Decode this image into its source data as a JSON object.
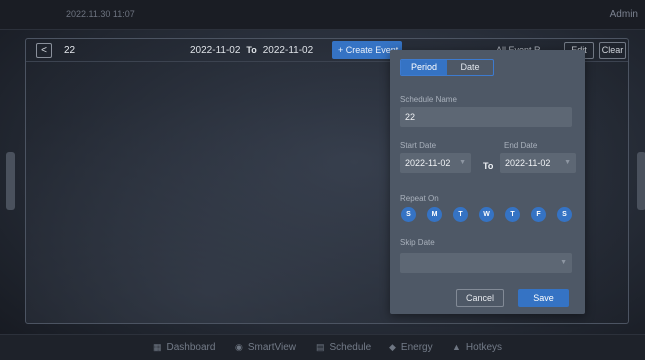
{
  "status": {
    "datetime": "2022.11.30  11:07",
    "user": "Admin"
  },
  "toolbar": {
    "back_icon": "<",
    "schedule_name": "22",
    "start_date": "2022-11-02",
    "to_label": "To",
    "end_date": "2022-11-02",
    "create_label": "+ Create Event",
    "all_events_label": "All Event R...",
    "edit_label": "Edit",
    "clear_label": "Clear"
  },
  "modal": {
    "tabs": [
      "Period",
      "Date"
    ],
    "active_tab": "Period",
    "schedule_name_label": "Schedule Name",
    "schedule_name_value": "22",
    "start_date_label": "Start Date",
    "start_date_value": "2022-11-02",
    "to_label": "To",
    "end_date_label": "End Date",
    "end_date_value": "2022-11-02",
    "repeat_on_label": "Repeat On",
    "days": [
      "S",
      "M",
      "T",
      "W",
      "T",
      "F",
      "S"
    ],
    "skip_date_label": "Skip Date",
    "skip_date_value": "",
    "cancel_label": "Cancel",
    "save_label": "Save"
  },
  "nav": [
    {
      "label": "Dashboard",
      "icon": "dashboard-icon"
    },
    {
      "label": "SmartView",
      "icon": "smartview-icon"
    },
    {
      "label": "Schedule",
      "icon": "schedule-icon"
    },
    {
      "label": "Energy",
      "icon": "energy-icon"
    },
    {
      "label": "Hotkeys",
      "icon": "hotkeys-icon"
    }
  ],
  "colors": {
    "accent": "#3573c4",
    "modal_bg": "#4e5866",
    "background": "#262c37"
  }
}
